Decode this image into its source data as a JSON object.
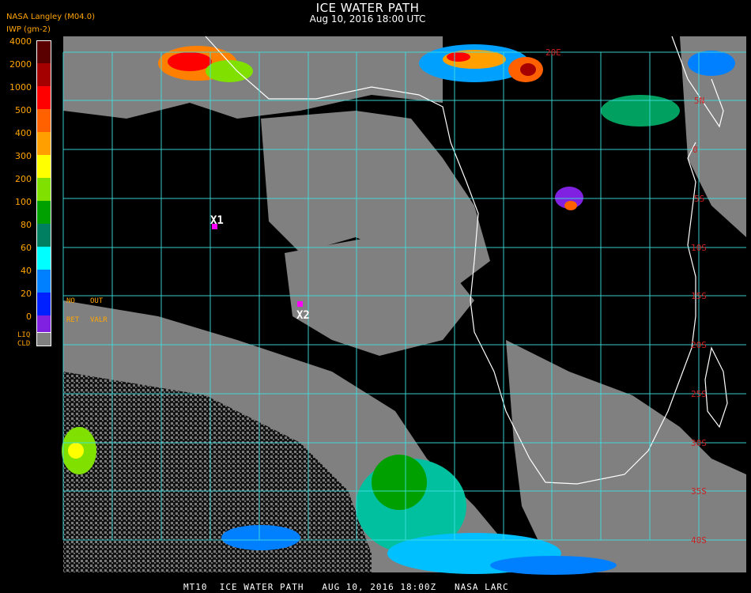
{
  "header": {
    "title": "ICE WATER PATH",
    "subtitle": "Aug 10, 2016 18:00 UTC",
    "source": "NASA Langley (M04.0)",
    "units": "IWP (gm-2)"
  },
  "legend": {
    "labels": [
      "4000",
      "2000",
      "1000",
      "500",
      "400",
      "300",
      "200",
      "100",
      "80",
      "60",
      "40",
      "20",
      "0"
    ],
    "colors": [
      "#5a0000",
      "#a40000",
      "#ff0000",
      "#ff6000",
      "#ffa000",
      "#ffff00",
      "#80e000",
      "#00a000",
      "#008060",
      "#00ffff",
      "#0080ff",
      "#0020ff",
      "#8020e0"
    ],
    "no_retrieval_top": [
      "NO",
      "OUT"
    ],
    "no_retrieval_bottom": [
      "RET",
      "VALR"
    ],
    "liquid_cloud": [
      "LIQ",
      "CLD"
    ],
    "liquid_cloud_color": "#808080"
  },
  "map": {
    "lon_labels": [
      "20E"
    ],
    "lat_labels": [
      "5N",
      "0",
      "5S",
      "10S",
      "15S",
      "20S",
      "25S",
      "30S",
      "35S",
      "40S"
    ],
    "markers": [
      {
        "label": "X1"
      },
      {
        "label": "X2"
      }
    ],
    "marker_color": "#ff00ff",
    "grid_color": "#40e0e0",
    "coast_color": "#ffffff",
    "label_color": "#cc2020"
  },
  "footer": {
    "caption": "MT10  ICE WATER PATH   AUG 10, 2016 18:00Z   NASA LARC"
  }
}
